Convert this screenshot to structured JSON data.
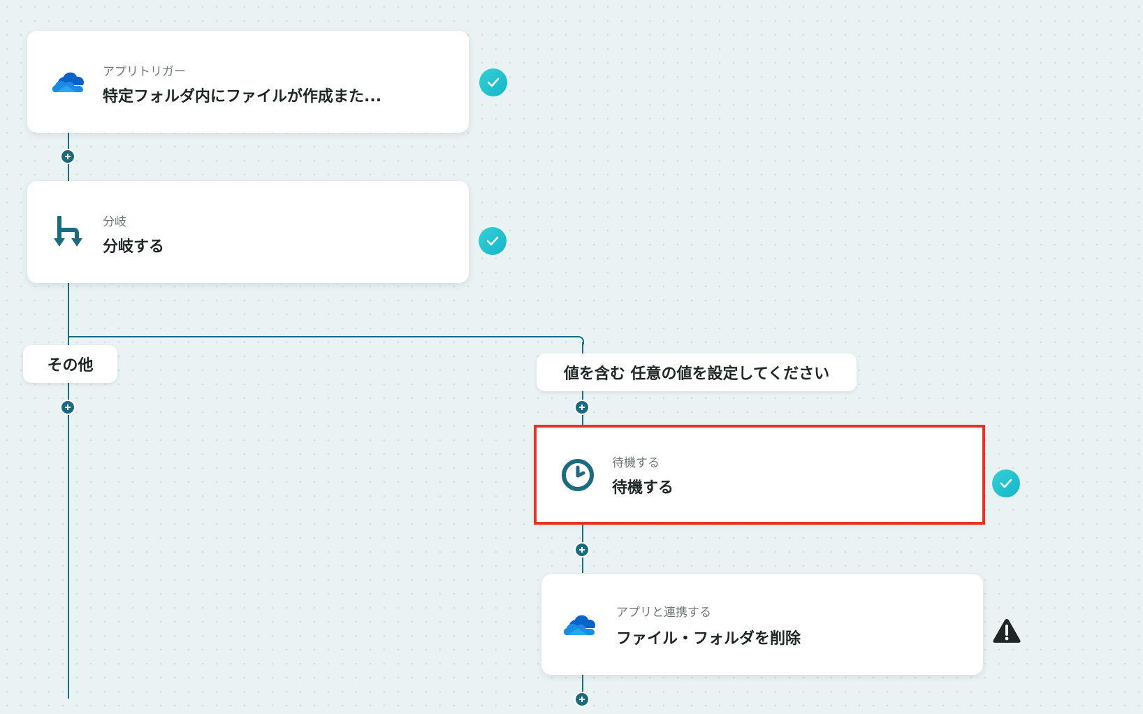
{
  "nodes": [
    {
      "subtitle": "アプリトリガー",
      "title": "特定フォルダ内にファイルが作成また..."
    },
    {
      "subtitle": "分岐",
      "title": "分岐する"
    },
    {
      "subtitle": "待機する",
      "title": "待機する"
    },
    {
      "subtitle": "アプリと連携する",
      "title": "ファイル・フォルダを削除"
    }
  ],
  "branches": {
    "other_label": "その他",
    "condition_label": "値を含む 任意の値を設定してください"
  },
  "colors": {
    "connector": "#1b6a80",
    "check": "#1fc2cf",
    "selected_border": "#e63323",
    "warning": "#1f2626"
  },
  "icons": {
    "trigger": "onedrive-cloud-icon",
    "branch": "branch-icon",
    "wait": "clock-icon",
    "action": "onedrive-cloud-icon",
    "status_ok": "check-icon",
    "status_warn": "warning-icon",
    "add": "plus-icon"
  }
}
